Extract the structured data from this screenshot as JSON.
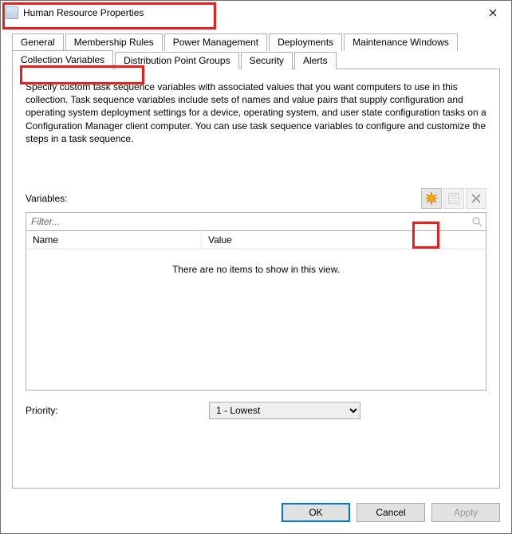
{
  "window": {
    "title": "Human Resource Properties"
  },
  "tabs": {
    "row1": [
      {
        "label": "General"
      },
      {
        "label": "Membership Rules"
      },
      {
        "label": "Power Management"
      },
      {
        "label": "Deployments"
      },
      {
        "label": "Maintenance Windows"
      }
    ],
    "row2": [
      {
        "label": "Collection Variables",
        "active": true
      },
      {
        "label": "Distribution Point Groups"
      },
      {
        "label": "Security"
      },
      {
        "label": "Alerts"
      }
    ]
  },
  "panel": {
    "description": "Specify custom task sequence variables with associated values that you want computers to use in this collection. Task sequence variables include sets of names and value pairs that supply configuration and operating system deployment settings for a device, operating system, and user state configuration tasks on a Configuration Manager client computer. You can use task sequence variables to configure and customize the steps in a task sequence.",
    "variables_label": "Variables:",
    "filter_placeholder": "Filter...",
    "columns": {
      "name": "Name",
      "value": "Value"
    },
    "empty_text": "There are no items to show in this view.",
    "priority_label": "Priority:",
    "priority_value": "1 - Lowest"
  },
  "footer": {
    "ok": "OK",
    "cancel": "Cancel",
    "apply": "Apply"
  }
}
